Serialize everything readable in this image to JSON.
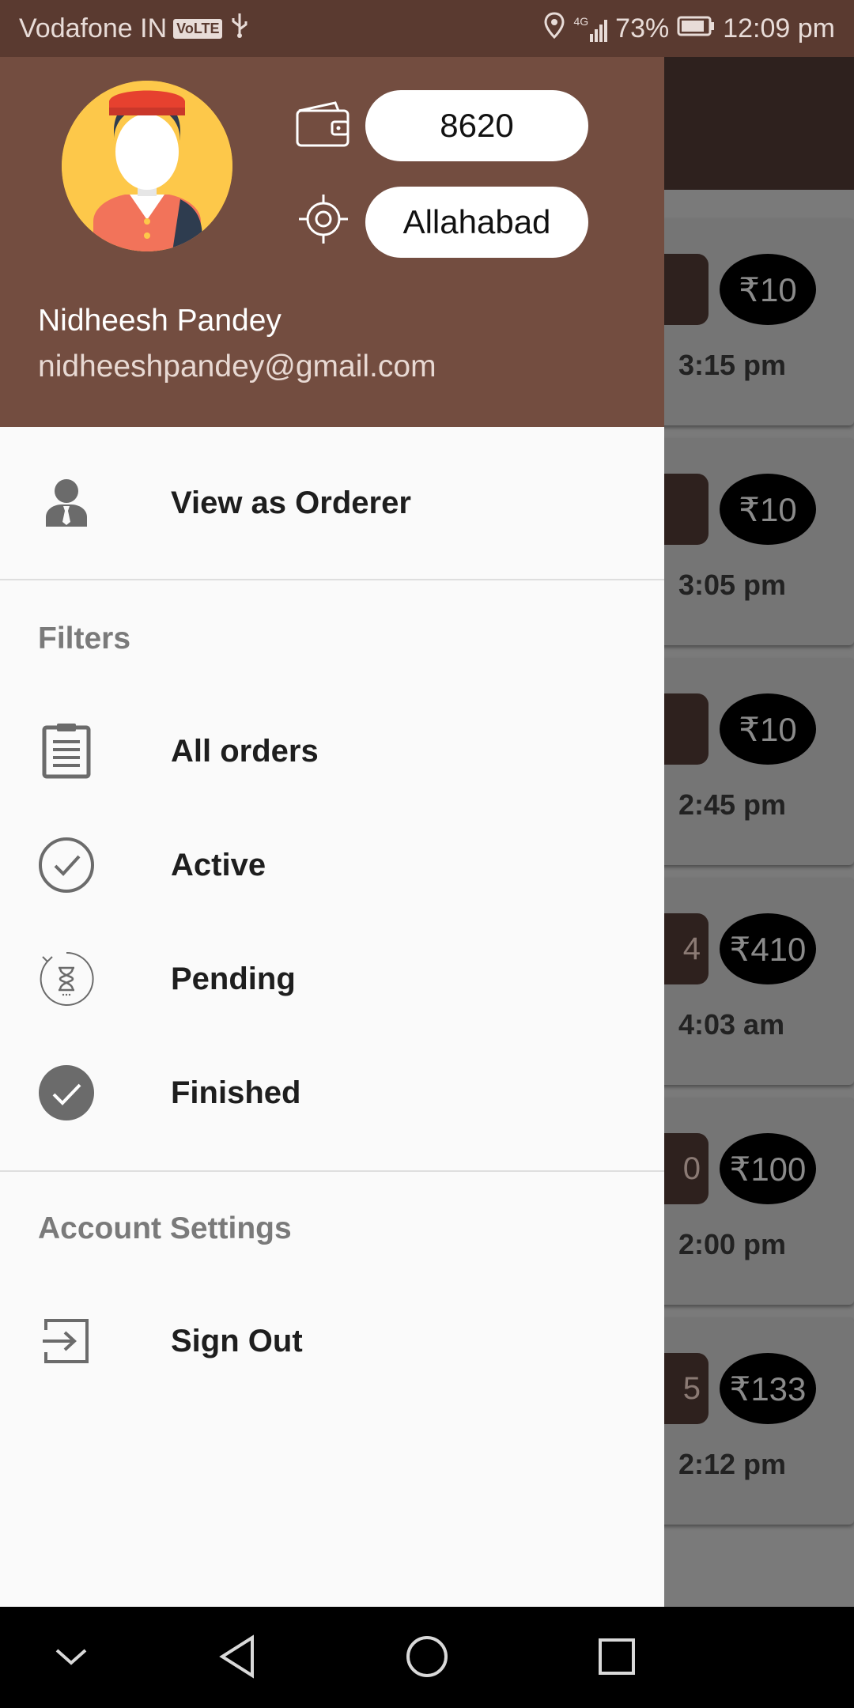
{
  "status_bar": {
    "carrier": "Vodafone IN",
    "volte": "VoLTE",
    "network": "4G",
    "battery": "73%",
    "time": "12:09 pm"
  },
  "drawer": {
    "balance": "8620",
    "city": "Allahabad",
    "user_name": "Nidheesh Pandey",
    "user_email": "nidheeshpandey@gmail.com",
    "view_as_orderer": "View as Orderer",
    "filters_title": "Filters",
    "filters": [
      {
        "label": "All orders",
        "icon": "clipboard-icon"
      },
      {
        "label": "Active",
        "icon": "check-circle-outline-icon"
      },
      {
        "label": "Pending",
        "icon": "hourglass-icon"
      },
      {
        "label": "Finished",
        "icon": "check-circle-filled-icon"
      }
    ],
    "account_title": "Account Settings",
    "sign_out": "Sign Out"
  },
  "background_orders": [
    {
      "chip": "",
      "price": "₹10",
      "time": "3:15 pm"
    },
    {
      "chip": "",
      "price": "₹10",
      "time": "3:05 pm"
    },
    {
      "chip": "",
      "price": "₹10",
      "time": "2:45 pm"
    },
    {
      "chip": "4",
      "price": "₹410",
      "time": "4:03 am"
    },
    {
      "chip": "0",
      "price": "₹100",
      "time": "2:00 pm"
    },
    {
      "chip": "5",
      "price": "₹133",
      "time": "2:12 pm"
    }
  ],
  "colors": {
    "header": "#734d40",
    "status_bar": "#5a3a30",
    "drawer_bg": "#fafafa",
    "icon_gray": "#6b6b6b"
  }
}
